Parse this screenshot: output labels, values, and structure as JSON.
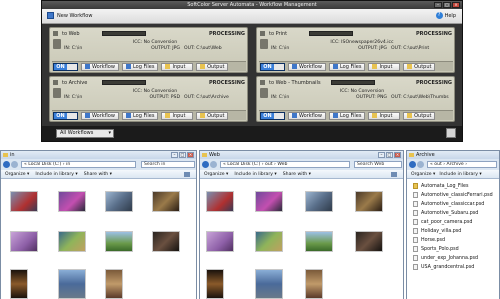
{
  "app": {
    "title": "SoftColor Server Automata - Workflow Management",
    "toolbar": {
      "new_workflow": "New Workflow",
      "help": "Help"
    },
    "footer": {
      "filter_value": "All Workflows"
    },
    "workflows": [
      {
        "name": "to Web",
        "status": "PROCESSING",
        "icc": "ICC: No Conversion",
        "in": "IN: C:\\in",
        "output": "OUTPUT: JPG",
        "out": "OUT: C:\\out\\Web"
      },
      {
        "name": "to Print",
        "status": "PROCESSING",
        "icc": "ICC: ISOnewspaper26v4.icc",
        "in": "IN: C:\\in",
        "output": "OUTPUT: JPG",
        "out": "OUT: C:\\out\\Print"
      },
      {
        "name": "to Archive",
        "status": "PROCESSING",
        "icc": "ICC: No Conversion",
        "in": "IN: C:\\in",
        "output": "OUTPUT: PSD",
        "out": "OUT: C:\\out\\Archive"
      },
      {
        "name": "to Web - Thumbnails",
        "status": "PROCESSING",
        "icc": "ICC: No Conversion",
        "in": "IN: C:\\in",
        "output": "OUTPUT: PNG",
        "out": "OUT: C:\\out\\Web\\Thumbs"
      }
    ],
    "controls": {
      "toggle": "ON",
      "workflow": "Workflow",
      "log_files": "Log Files",
      "input": "Input",
      "output": "Output"
    }
  },
  "explorers": [
    {
      "title": "in",
      "path": "« Local Disk (C:) › in",
      "search": "Search in",
      "tools": [
        "Organize ▾",
        "Include in library ▾",
        "Share with ▾"
      ]
    },
    {
      "title": "Web",
      "path": "« Local Disk (C:) › out › Web",
      "search": "Search Web",
      "tools": [
        "Organize ▾",
        "Include in library ▾",
        "Share with ▾"
      ]
    },
    {
      "title": "Archive",
      "path": "« out › Archive ›",
      "search": "",
      "tools": [
        "Organize ▾",
        "Include in library ▾"
      ],
      "files": [
        "Automata_Log_Files",
        "Automotive_classicFerrari.psd",
        "Automotive_classiccar.psd",
        "Automotive_Subaru.psd",
        "cat_poor_camera.psd",
        "Holiday_villa.psd",
        "Horse.psd",
        "Sports_Polo.psd",
        "under_exp_Johanna.psd",
        "USA_grandcentral.psd"
      ]
    }
  ],
  "colors": {
    "app_bg": "#2b2b2b",
    "panel": "#d4d3c3",
    "explorer_chrome": "#cfdbe9",
    "accent_blue": "#3a7fd9"
  }
}
